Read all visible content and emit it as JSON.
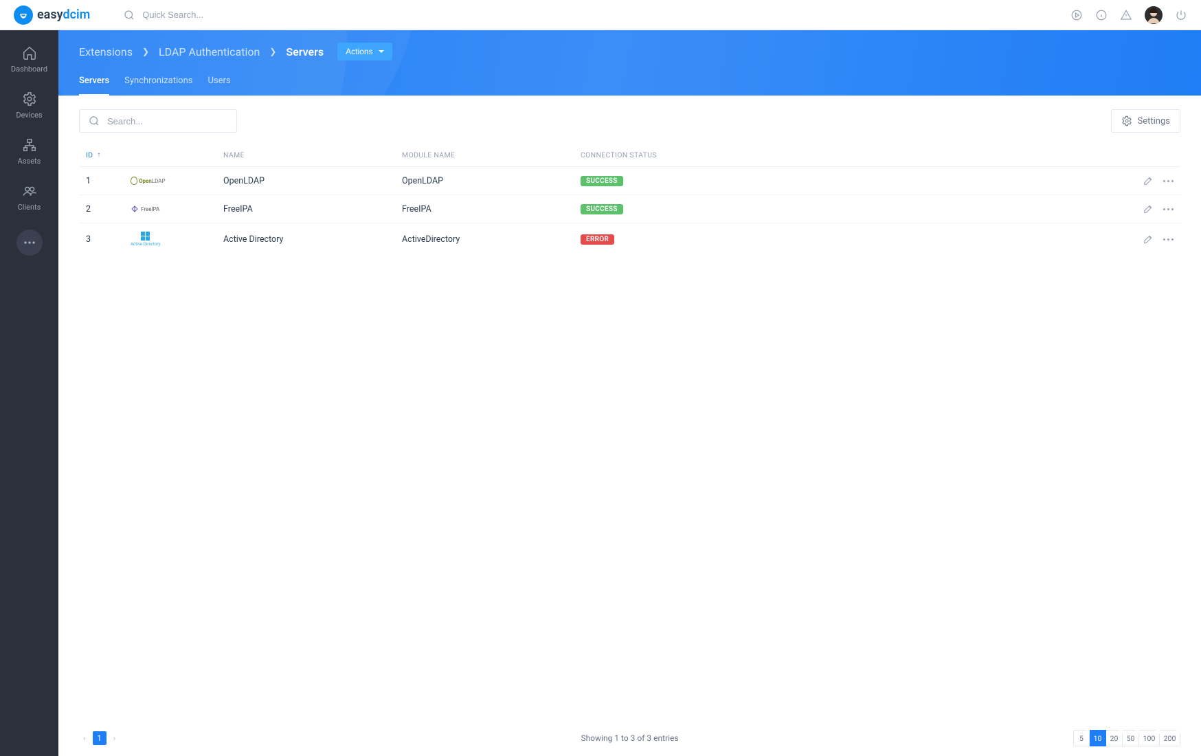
{
  "brand": {
    "name_a": "easy",
    "name_b": "dcim"
  },
  "search": {
    "placeholder": "Quick Search..."
  },
  "sidebar": {
    "items": [
      {
        "label": "Dashboard"
      },
      {
        "label": "Devices"
      },
      {
        "label": "Assets"
      },
      {
        "label": "Clients"
      }
    ]
  },
  "breadcrumb": {
    "a": "Extensions",
    "b": "LDAP Authentication",
    "c": "Servers",
    "actions": "Actions"
  },
  "tabs": {
    "a": "Servers",
    "b": "Synchronizations",
    "c": "Users"
  },
  "toolbar": {
    "search_placeholder": "Search...",
    "settings": "Settings"
  },
  "columns": {
    "id": "ID",
    "name": "NAME",
    "module": "MODULE NAME",
    "status": "CONNECTION STATUS"
  },
  "rows": [
    {
      "id": "1",
      "name": "OpenLDAP",
      "module": "OpenLDAP",
      "status": "SUCCESS",
      "status_kind": "success"
    },
    {
      "id": "2",
      "name": "FreeIPA",
      "module": "FreeIPA",
      "status": "SUCCESS",
      "status_kind": "success"
    },
    {
      "id": "3",
      "name": "Active Directory",
      "module": "ActiveDirectory",
      "status": "ERROR",
      "status_kind": "error"
    }
  ],
  "footer": {
    "prev": "‹",
    "next": "›",
    "page": "1",
    "info": "Showing 1 to 3 of 3 entries",
    "sizes": [
      "5",
      "10",
      "20",
      "50",
      "100",
      "200"
    ],
    "active_size": "10"
  }
}
